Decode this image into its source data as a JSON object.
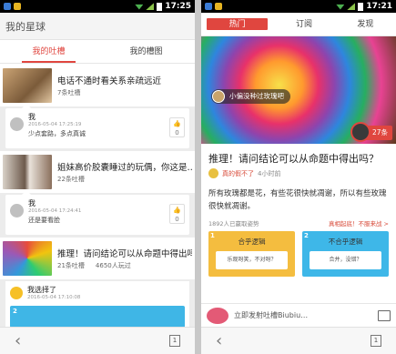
{
  "left": {
    "status": {
      "time": "17:25"
    },
    "title": "我的星球",
    "tabs": [
      "我的吐槽",
      "我的槽图"
    ],
    "feed": [
      {
        "title": "电话不通时看关系亲疏远近",
        "meta1": "7条吐槽",
        "meta2": "",
        "comment": {
          "user": "我",
          "time": "2016-05-04 17:25:19",
          "text": "少点套路，多点真诚",
          "likes": "0"
        }
      },
      {
        "title": "姐妹高价胶囊睡过的玩偶，你这是…",
        "meta1": "22条吐槽",
        "meta2": "",
        "comment": {
          "user": "我",
          "time": "2016-05-04 17:24:41",
          "text": "还是要看脸",
          "likes": "0"
        }
      },
      {
        "title": "推理！请问结论可以从命题中得出吗",
        "meta1": "21条吐槽",
        "meta2": "4650人玩过",
        "comment": {
          "user": "我选择了",
          "time": "2016-05-04 17:10:08",
          "text": "",
          "likes": ""
        }
      }
    ],
    "mini_num": "2",
    "page": "1"
  },
  "right": {
    "status": {
      "time": "17:21"
    },
    "tabs": [
      "热门",
      "订阅",
      "发现"
    ],
    "category": "小偏没种过玫瑰吧",
    "badge": "27条",
    "question": "推理！请问结论可以从命题中得出吗？",
    "author": "真的假不了",
    "ago": "4小时前",
    "body": "所有玫瑰都是花，有些花很快就凋谢，所以有些玫瑰很快就凋谢。",
    "played": "1892人已赢取姿势",
    "report": "真相起底！不服来战 >",
    "options": [
      {
        "no": "1",
        "label": "合乎逻辑",
        "inner": "乐观呀笑，不对呀？",
        "color": "#f4bd3f"
      },
      {
        "no": "2",
        "label": "不合乎逻辑",
        "inner": "合并，没错？",
        "color": "#3eb7e8"
      }
    ],
    "comment_placeholder": "立即发射吐槽Biubiu…",
    "page": "1"
  }
}
